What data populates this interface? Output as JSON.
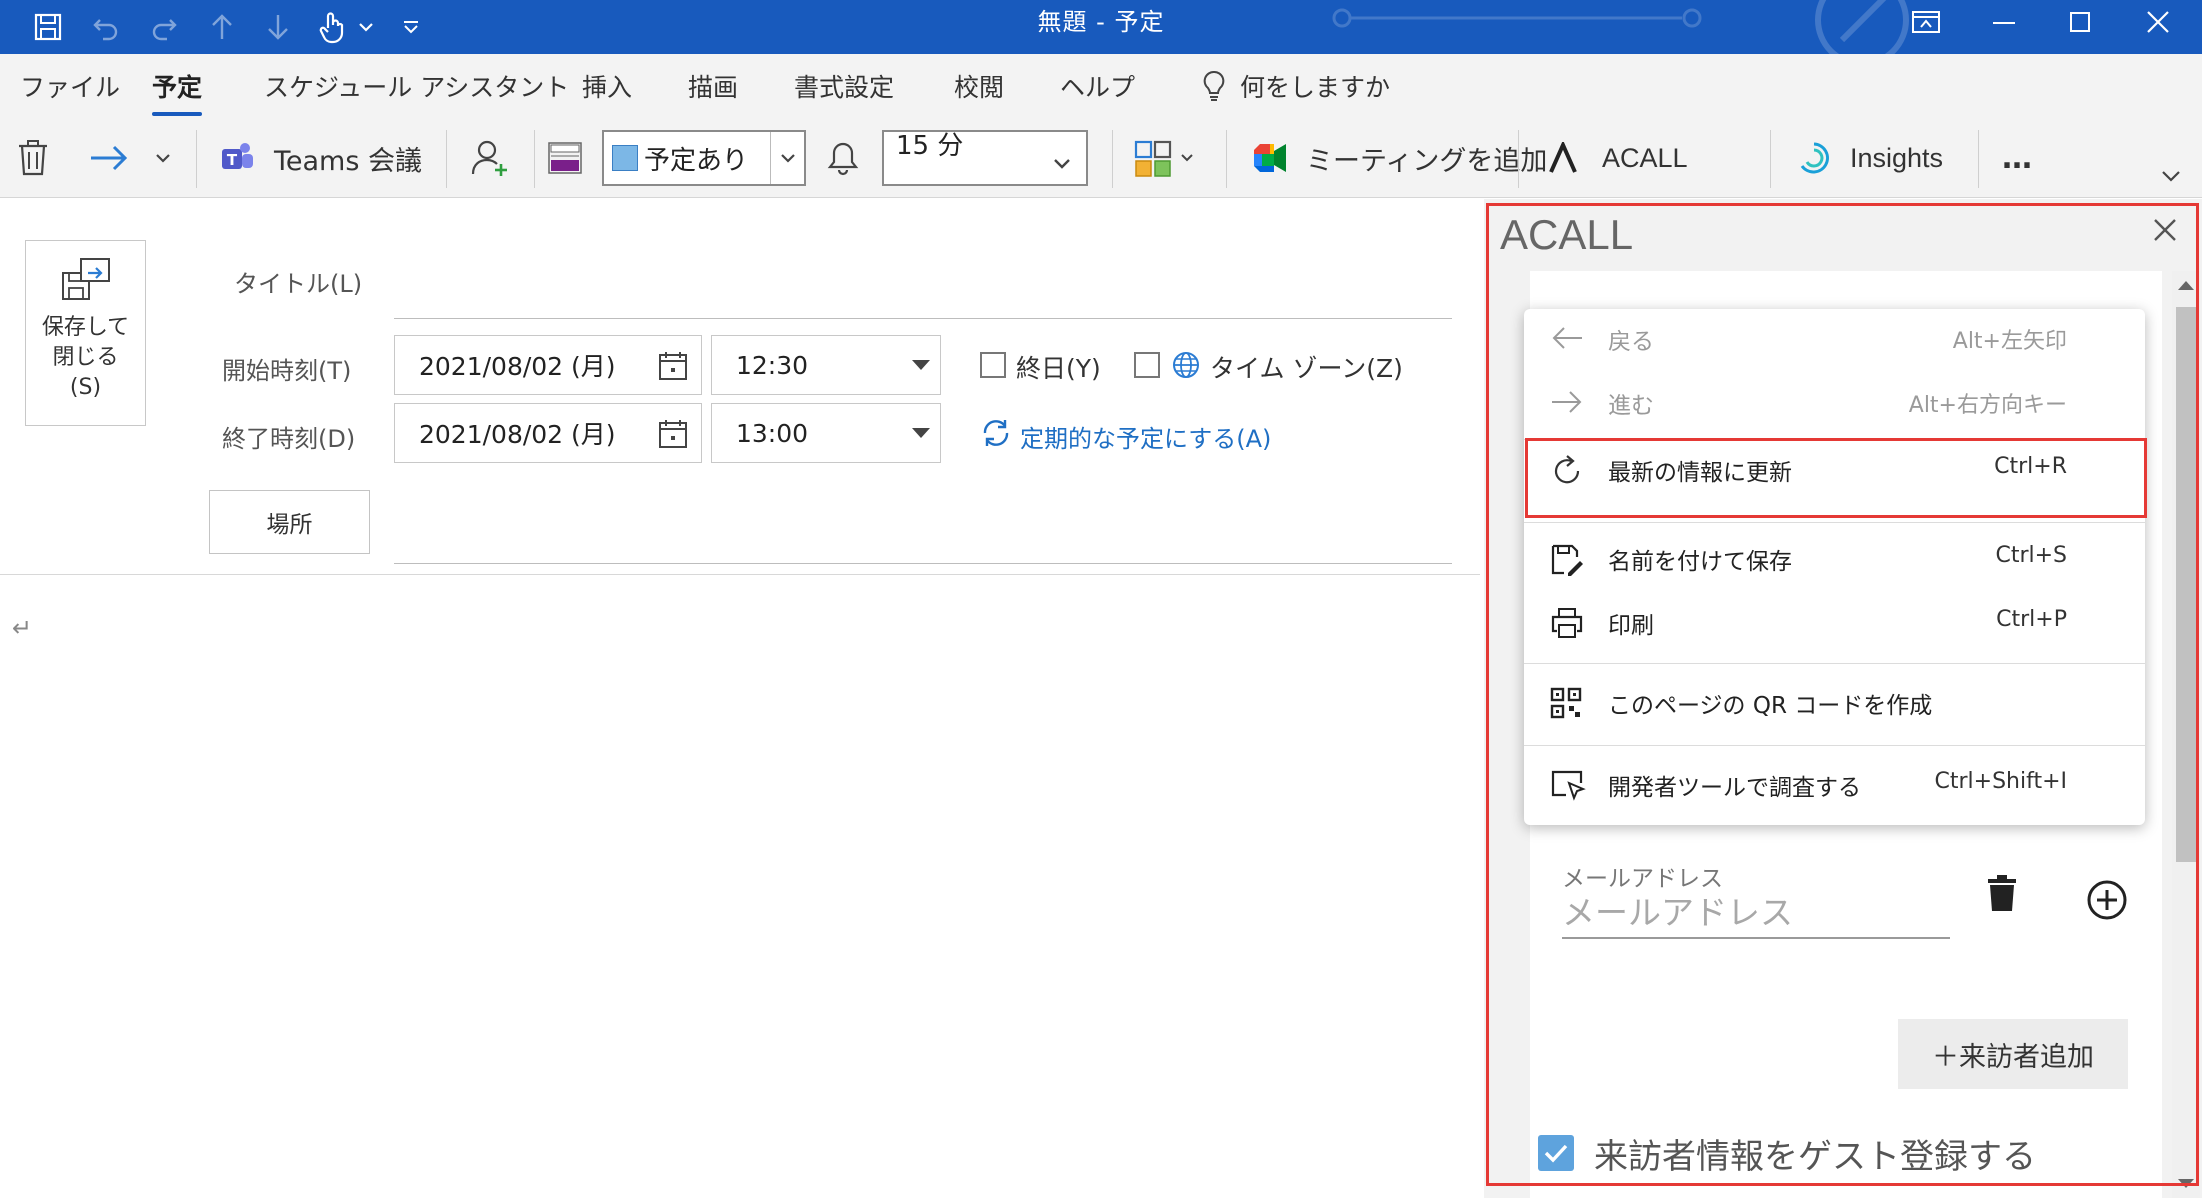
{
  "window": {
    "title": "無題 - 予定"
  },
  "tabs": [
    {
      "label": "ファイル"
    },
    {
      "label": "予定"
    },
    {
      "label": "スケジュール アシスタント"
    },
    {
      "label": "挿入"
    },
    {
      "label": "描画"
    },
    {
      "label": "書式設定"
    },
    {
      "label": "校閲"
    },
    {
      "label": "ヘルプ"
    }
  ],
  "tell_me": "何をしますか",
  "toolbar": {
    "teams_label": "Teams 会議",
    "show_as_value": "予定あり",
    "reminder_value": "15 分",
    "meeting_addin_label": "ミーティングを追加",
    "acall_label": "ACALL",
    "insights_label": "Insights",
    "more_label": "…"
  },
  "form": {
    "save_close_label_1": "保存して",
    "save_close_label_2": "閉じる",
    "save_close_label_3": "(S)",
    "title_label": "タイトル(L)",
    "start_label": "開始時刻(T)",
    "end_label": "終了時刻(D)",
    "start_date": "2021/08/02 (月)",
    "start_time": "12:30",
    "end_date": "2021/08/02 (月)",
    "end_time": "13:00",
    "all_day_label": "終日(Y)",
    "time_zone_label": "タイム ゾーン(Z)",
    "recurrence_label": "定期的な予定にする(A)",
    "location_button": "場所",
    "body_mark": "↵"
  },
  "panel": {
    "title": "ACALL",
    "email_label": "メールアドレス",
    "email_placeholder": "メールアドレス",
    "add_visitor_label": "＋来訪者追加",
    "guest_register_label": "来訪者情報をゲスト登録する",
    "guest_register_checked": true
  },
  "context_menu": {
    "items": [
      {
        "label": "戻る",
        "shortcut": "Alt+左矢印",
        "icon": "arrow-left-icon",
        "disabled": true
      },
      {
        "label": "進む",
        "shortcut": "Alt+右方向キー",
        "icon": "arrow-right-icon",
        "disabled": true
      },
      {
        "label": "最新の情報に更新",
        "shortcut": "Ctrl+R",
        "icon": "refresh-icon",
        "disabled": false
      },
      {
        "label": "名前を付けて保存",
        "shortcut": "Ctrl+S",
        "icon": "save-as-icon",
        "disabled": false
      },
      {
        "label": "印刷",
        "shortcut": "Ctrl+P",
        "icon": "print-icon",
        "disabled": false
      },
      {
        "label": "このページの QR コードを作成",
        "shortcut": "",
        "icon": "qr-code-icon",
        "disabled": false
      },
      {
        "label": "開発者ツールで調査する",
        "shortcut": "Ctrl+Shift+I",
        "icon": "devtools-icon",
        "disabled": false
      }
    ]
  },
  "colors": {
    "titlebar": "#185abd",
    "highlight": "#e53935",
    "link": "#1f6fc4",
    "checkbox_checked": "#5ea3dd"
  }
}
